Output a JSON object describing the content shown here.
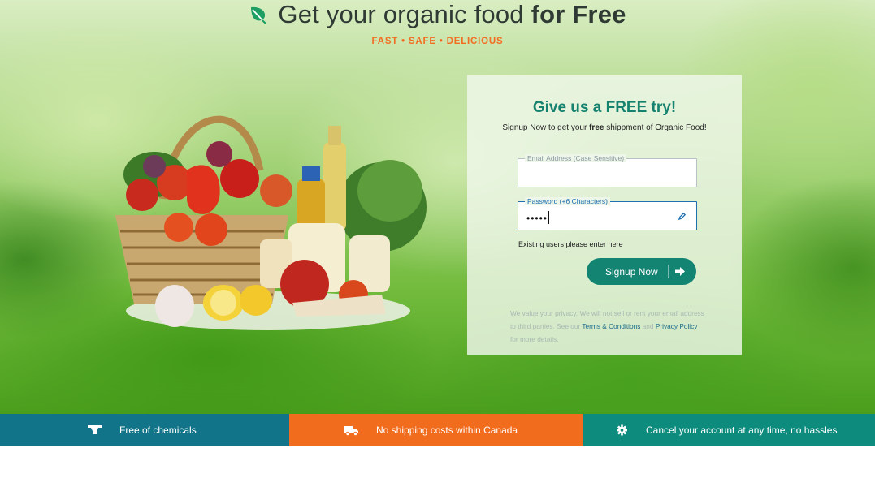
{
  "header": {
    "headline_prefix": "Get your organic food",
    "headline_bold": "for Free",
    "tagline": "FAST • SAFE • DELICIOUS",
    "leaf_icon": "leaf-icon"
  },
  "form": {
    "title": "Give us a FREE try!",
    "subtitle_prefix": "Signup Now to get your",
    "subtitle_bold": "free",
    "subtitle_suffix": "shippment of Organic Food!",
    "email_label": "Email Address (Case Sensitive)",
    "email_value": "",
    "password_label": "Password (+6 Characters)",
    "password_value": "•••••",
    "existing_users": "Existing users please enter here",
    "signup_label": "Signup Now",
    "privacy_text_1": "We value your privacy. We will not sell or rent your email address to third parties. See our",
    "terms_link": "Terms & Conditions",
    "privacy_and": "and",
    "privacy_link": "Privacy Policy",
    "privacy_text_2": "for more details."
  },
  "features": [
    {
      "label": "Free of chemicals",
      "icon": "flask-icon",
      "color": "#127488"
    },
    {
      "label": "No shipping costs within Canada",
      "icon": "truck-icon",
      "color": "#f26c1d"
    },
    {
      "label": "Cancel your account at any time, no hassles",
      "icon": "gear-icon",
      "color": "#0d8c7e"
    }
  ],
  "colors": {
    "accent": "#138372",
    "orange": "#f26d21",
    "title": "#14826e"
  }
}
